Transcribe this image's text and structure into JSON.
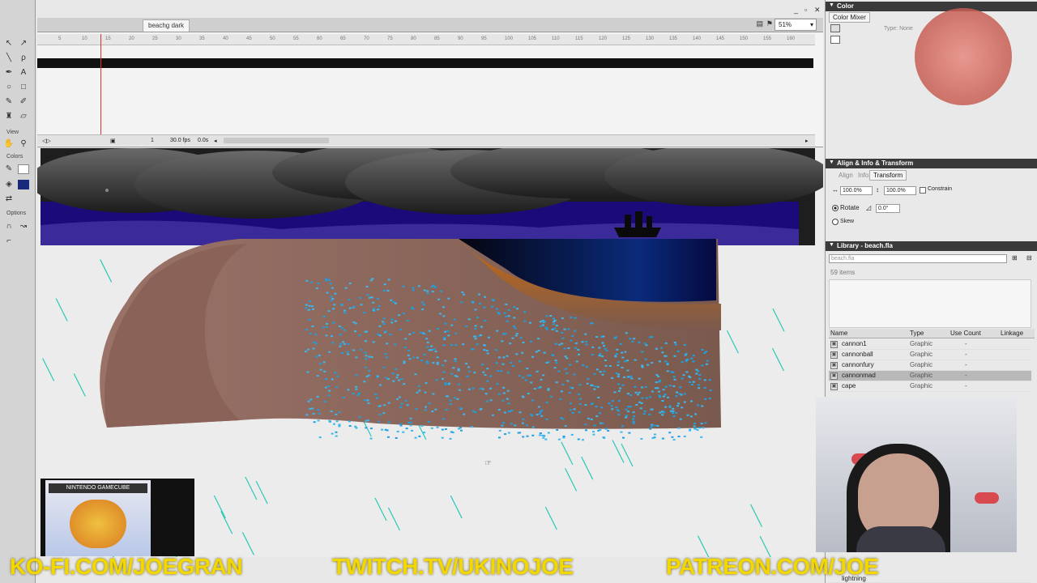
{
  "tools": {
    "view_label": "View",
    "colors_label": "Colors",
    "options_label": "Options"
  },
  "document": {
    "tab_active": "beachg dark",
    "zoom": "51%"
  },
  "timeline": {
    "frame": "1",
    "fps": "30.0 fps",
    "time": "0.0s",
    "ruler": [
      "5",
      "10",
      "15",
      "20",
      "25",
      "30",
      "35",
      "40",
      "45",
      "50",
      "55",
      "60",
      "65",
      "70",
      "75",
      "80",
      "85",
      "90",
      "95",
      "100",
      "105",
      "110",
      "115",
      "120",
      "125",
      "130",
      "135",
      "140",
      "145",
      "150",
      "155",
      "160"
    ]
  },
  "color_panel": {
    "title": "Color",
    "tab": "Color Mixer",
    "type_label": "Type:",
    "type_value": "None"
  },
  "align_panel": {
    "title": "Align & Info & Transform",
    "tabs": [
      "Align",
      "Info",
      "Transform"
    ],
    "width": "100.0%",
    "height": "100.0%",
    "constrain": "Constrain",
    "rotate_label": "Rotate",
    "rotate_value": "0.0°",
    "skew_label": "Skew"
  },
  "library": {
    "title": "Library - beach.fla",
    "dropdown": "beach.fla",
    "count": "59 items",
    "columns": [
      "Name",
      "Type",
      "Use Count",
      "Linkage"
    ],
    "items": [
      {
        "name": "cannon1",
        "type": "Graphic",
        "use": "-"
      },
      {
        "name": "cannonball",
        "type": "Graphic",
        "use": "-"
      },
      {
        "name": "cannonfury",
        "type": "Graphic",
        "use": "-"
      },
      {
        "name": "cannonmad",
        "type": "Graphic",
        "use": "-"
      },
      {
        "name": "cape",
        "type": "Graphic",
        "use": "-"
      }
    ],
    "bottom_item": "lightning"
  },
  "overlay": {
    "gamecube": "NINTENDO GAMECUBE",
    "banner": [
      "KO-FI.COM/JOEGRAN",
      "TWITCH.TV/UKINOJOE",
      "PATREON.COM/JOE"
    ]
  },
  "colors": {
    "sky_dark": "#2a2a2a",
    "ocean": "#1a0a7a",
    "sand": "#8a6456",
    "rain": "#28c8b8",
    "dots": "#1ea0e0",
    "banner": "#f2d800"
  }
}
